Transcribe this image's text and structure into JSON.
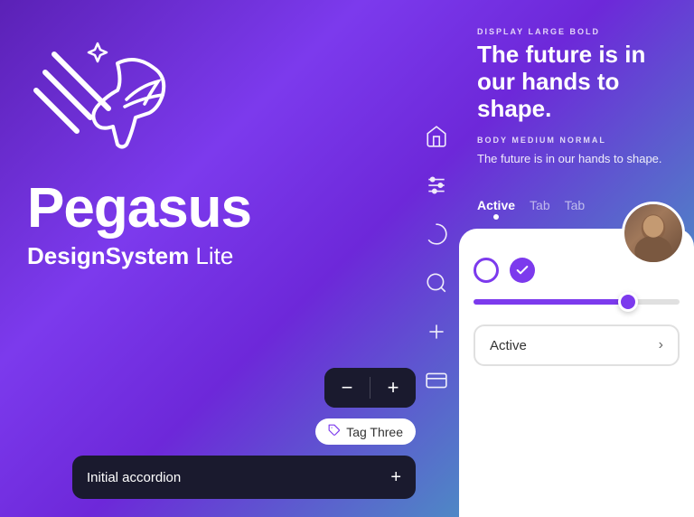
{
  "brand": {
    "name": "Pegasus",
    "sub_bold": "DesignSystem",
    "sub_light": " Lite"
  },
  "nav_icons": [
    {
      "name": "home-icon",
      "type": "home"
    },
    {
      "name": "settings-icon",
      "type": "sliders"
    },
    {
      "name": "loading-icon",
      "type": "circle"
    },
    {
      "name": "search-icon",
      "type": "search"
    },
    {
      "name": "add-icon",
      "type": "plus"
    },
    {
      "name": "card-icon",
      "type": "card"
    }
  ],
  "display": {
    "eyebrow": "DISPLAY LARGE BOLD",
    "heading": "The future is in our hands to shape.",
    "body_eyebrow": "BODY MEDIUM NORMAL",
    "body_text": "The future is in our hands to shape."
  },
  "tabs": [
    {
      "label": "Active",
      "active": true
    },
    {
      "label": "Tab",
      "active": false
    },
    {
      "label": "Tab",
      "active": false
    }
  ],
  "stepper": {
    "minus": "−",
    "plus": "+"
  },
  "tag": {
    "label": "Tag Three",
    "icon": "🏷"
  },
  "accordion": {
    "label": "Initial accordion",
    "icon": "+"
  },
  "radio": {
    "unchecked_label": "radio-unchecked",
    "checked_label": "radio-checked",
    "check_symbol": "✓"
  },
  "active_dropdown": {
    "label": "Active",
    "chevron": "›"
  },
  "colors": {
    "purple": "#7c3aed",
    "dark": "#1a1a2e",
    "white": "#ffffff"
  }
}
